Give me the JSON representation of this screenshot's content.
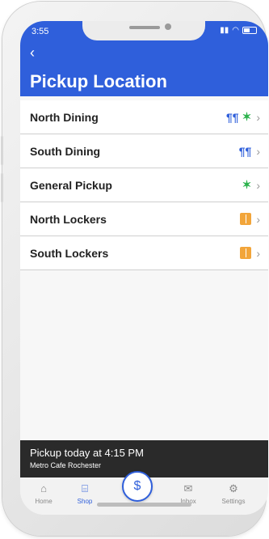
{
  "status": {
    "time": "3:55"
  },
  "header": {
    "title": "Pickup Location"
  },
  "locations": [
    {
      "label": "North Dining"
    },
    {
      "label": "South Dining"
    },
    {
      "label": "General Pickup"
    },
    {
      "label": "North Lockers"
    },
    {
      "label": "South Lockers"
    }
  ],
  "pickup": {
    "title": "Pickup today at 4:15 PM",
    "subtitle": "Metro Cafe Rochester"
  },
  "tabs": [
    {
      "label": "Home"
    },
    {
      "label": "Shop"
    },
    {
      "label": "Inbox"
    },
    {
      "label": "Settings"
    }
  ],
  "icons": {
    "back": "chevron-left-icon",
    "dining": "utensils-icon",
    "pickup": "running-person-icon",
    "locker": "locker-icon",
    "row": "chevron-right-icon",
    "center": "dollar-icon",
    "home": "home-icon",
    "shop": "store-icon",
    "inbox": "mail-icon",
    "settings": "gear-icon"
  },
  "colors": {
    "accent": "#2f5fdb",
    "run": "#2bb24c",
    "locker": "#f2a53a",
    "dark": "#2a2a2a"
  }
}
